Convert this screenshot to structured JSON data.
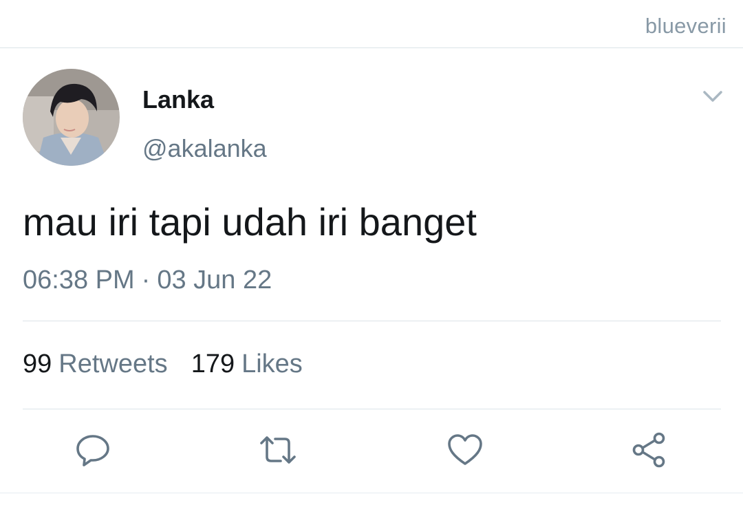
{
  "watermark": "blueverii",
  "tweet": {
    "display_name": "Lanka",
    "handle": "@akalanka",
    "text": "mau iri tapi udah iri banget",
    "time": "06:38 PM",
    "separator": "·",
    "date": "03 Jun 22"
  },
  "stats": {
    "retweets_count": "99",
    "retweets_label": "Retweets",
    "likes_count": "179",
    "likes_label": "Likes"
  },
  "icons": {
    "menu": "chevron-down-icon",
    "reply": "comment-icon",
    "retweet": "retweet-icon",
    "like": "heart-icon",
    "share": "share-icon"
  },
  "colors": {
    "primary_text": "#14171a",
    "secondary_text": "#657786",
    "watermark": "#8899a6",
    "divider": "#dbe3e8",
    "icon": "#657786"
  }
}
